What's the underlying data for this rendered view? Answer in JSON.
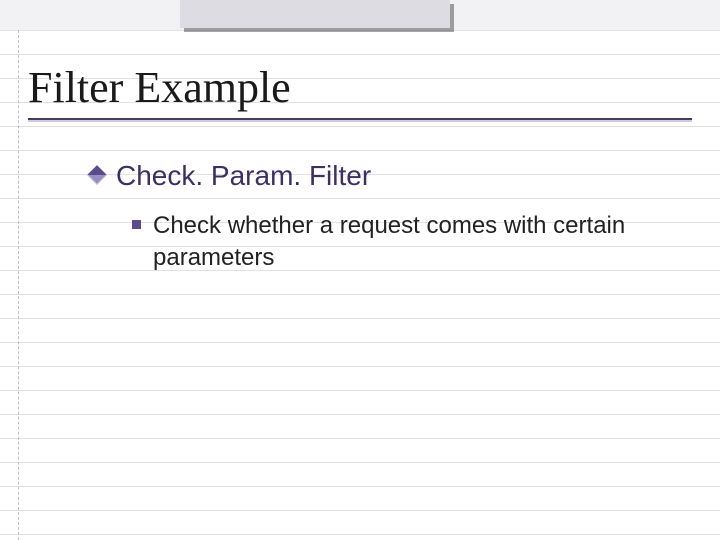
{
  "title": "Filter Example",
  "bullet1": {
    "text": "Check. Param. Filter"
  },
  "bullet2": {
    "text": "Check whether a request comes with certain parameters"
  }
}
